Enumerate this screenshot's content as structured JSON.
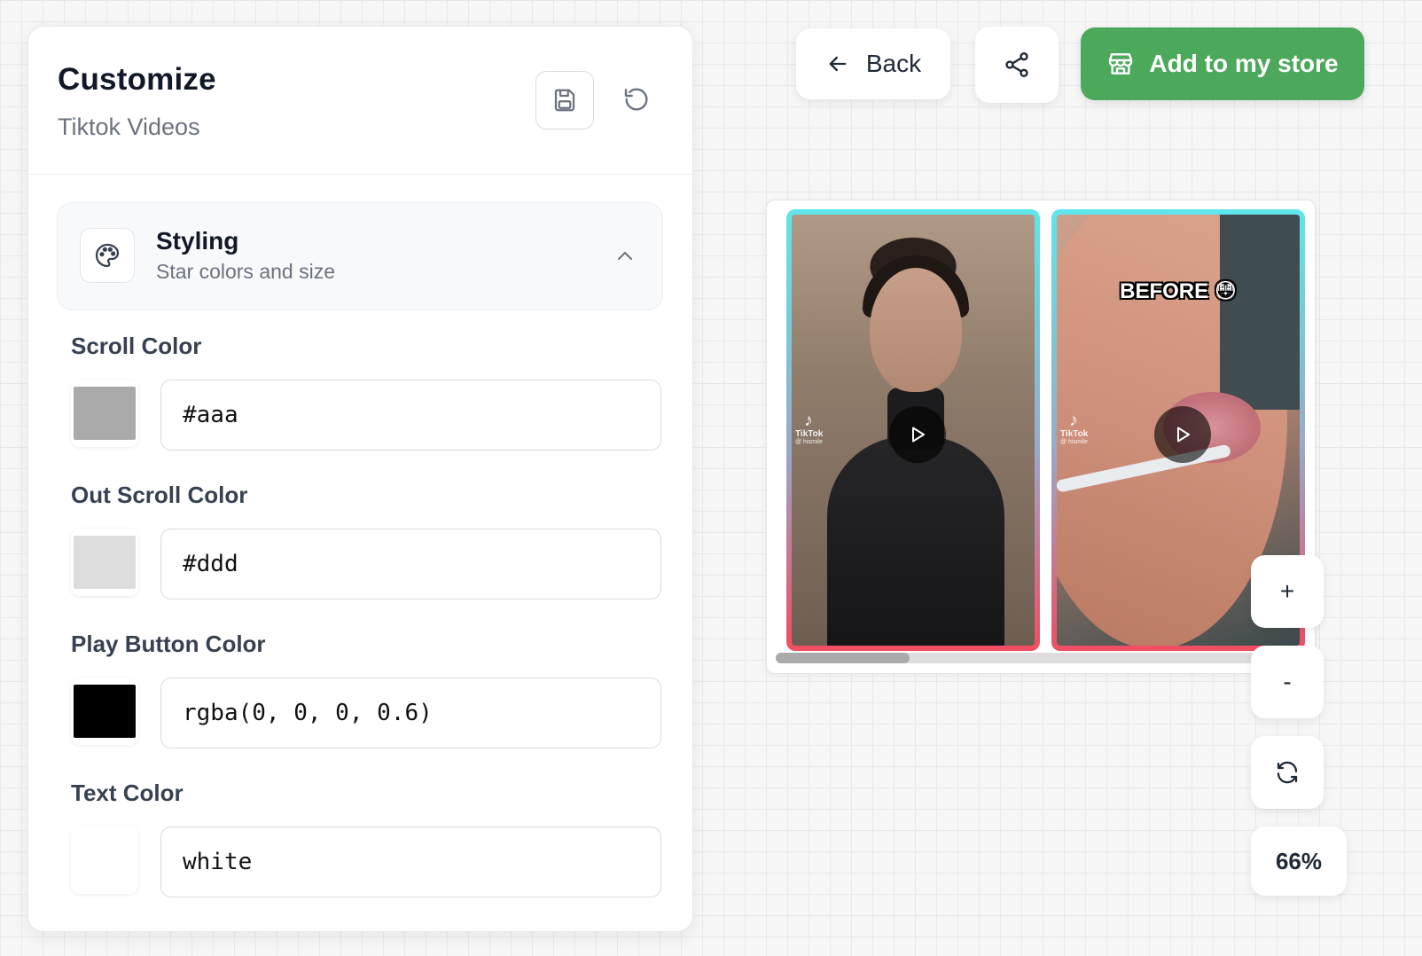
{
  "panel": {
    "title": "Customize",
    "subtitle": "Tiktok Videos",
    "save_icon": "save-icon",
    "reset_icon": "reset-icon"
  },
  "section": {
    "icon": "palette-icon",
    "title": "Styling",
    "subtitle": "Star colors and size",
    "chevron_icon": "chevron-up-icon"
  },
  "fields": [
    {
      "label": "Scroll Color",
      "value": "#aaa",
      "swatch": "#aaaaaa"
    },
    {
      "label": "Out Scroll Color",
      "value": "#ddd",
      "swatch": "#dddddd"
    },
    {
      "label": "Play Button Color",
      "value": "rgba(0, 0, 0, 0.6)",
      "swatch": "#000000"
    },
    {
      "label": "Text Color",
      "value": "white",
      "swatch": "#ffffff"
    }
  ],
  "toolbar": {
    "back_label": "Back",
    "back_icon": "arrow-left-icon",
    "share_icon": "share-icon",
    "add_label": "Add to my store",
    "add_icon": "store-icon",
    "add_color": "#4ca85a"
  },
  "preview": {
    "videos": [
      {
        "overlay_text": "",
        "brand": "TikTok",
        "handle": "@ hismile"
      },
      {
        "overlay_text": "BEFORE 😳",
        "brand": "TikTok",
        "handle": "@ hismile"
      }
    ],
    "scroll_position": 0.27
  },
  "zoom": {
    "in_label": "+",
    "out_label": "-",
    "reset_icon": "refresh-icon",
    "level": "66%"
  }
}
